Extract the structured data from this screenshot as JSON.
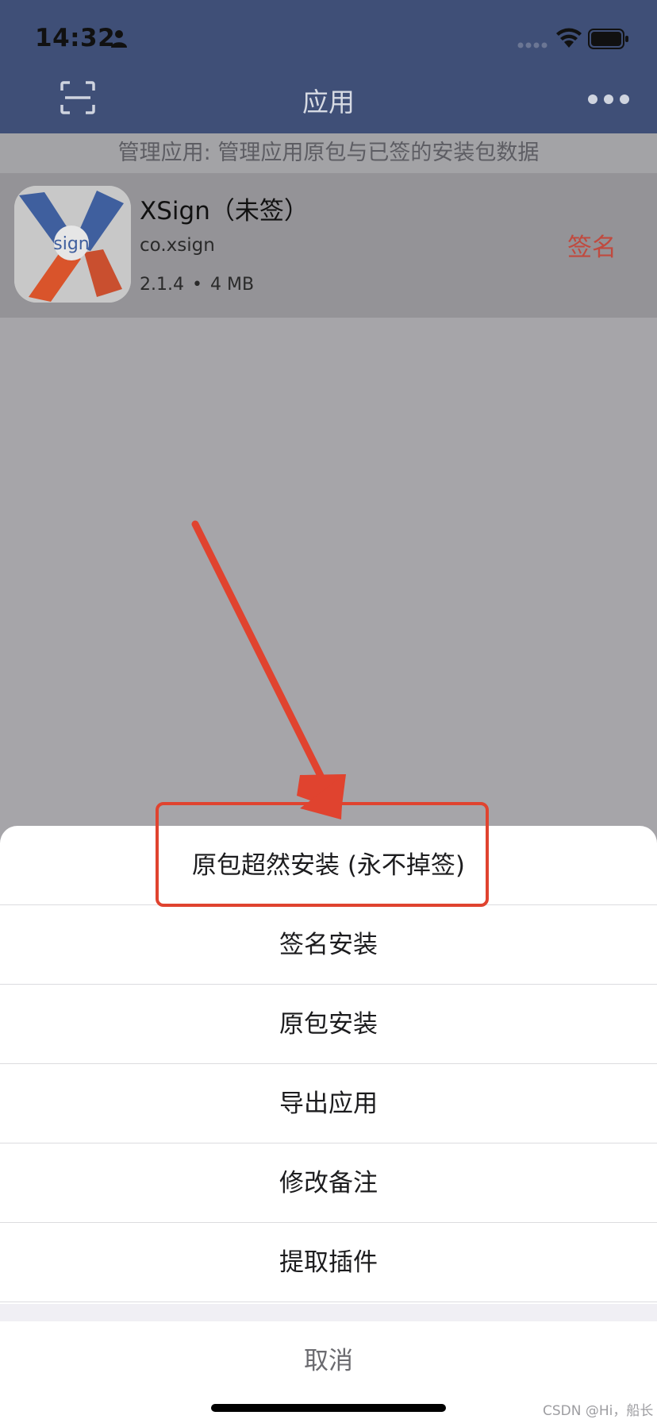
{
  "status_bar": {
    "time": "14:32"
  },
  "nav": {
    "title": "应用"
  },
  "info_bar": {
    "text": "管理应用: 管理应用原包与已签的安装包数据"
  },
  "app": {
    "name": "XSign（未签）",
    "bundle_id": "co.xsign",
    "version": "2.1.4",
    "separator": "•",
    "size": "4 MB",
    "sign_action": "签名",
    "icon_text": "sign"
  },
  "sheet": {
    "items": [
      {
        "label": "原包超然安装 (永不掉签)"
      },
      {
        "label": "签名安装"
      },
      {
        "label": "原包安装"
      },
      {
        "label": "导出应用"
      },
      {
        "label": "修改备注"
      },
      {
        "label": "提取插件"
      }
    ],
    "cancel": "取消"
  },
  "watermark": "CSDN @Hi，船长",
  "colors": {
    "nav_bg": "#3f4f77",
    "accent_red": "#c04a3f",
    "annotation_red": "#e0432f"
  }
}
